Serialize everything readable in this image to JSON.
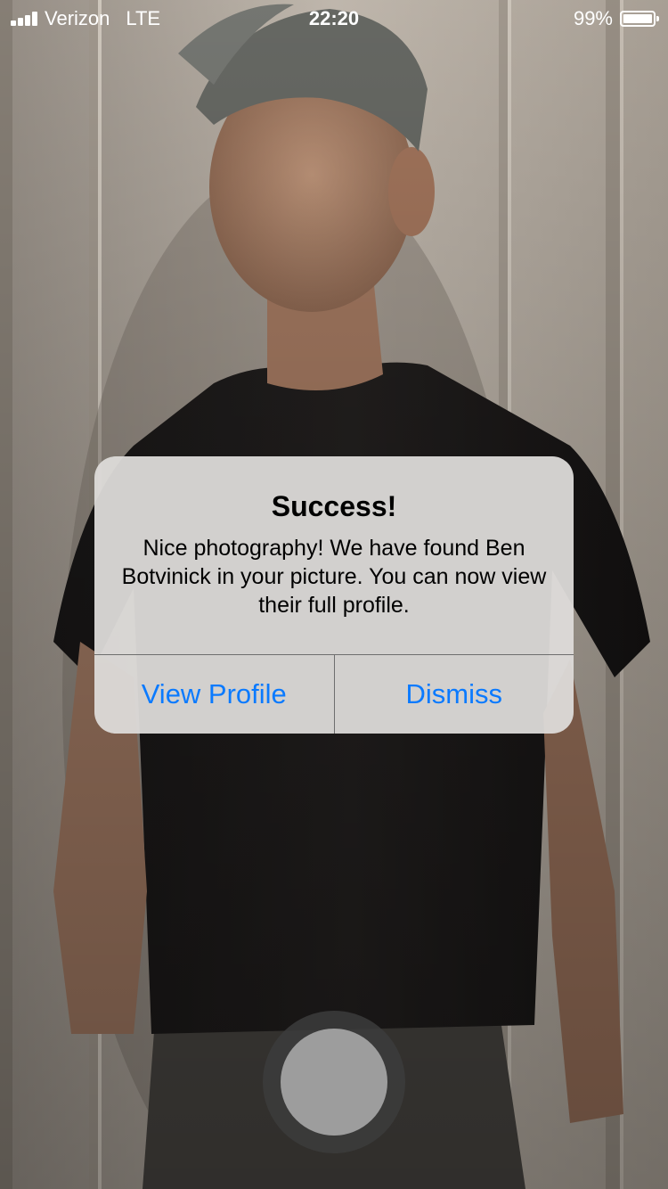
{
  "status_bar": {
    "carrier": "Verizon",
    "network": "LTE",
    "time": "22:20",
    "battery_percent": "99%",
    "battery_level": 0.99,
    "signal_bars": 4
  },
  "alert": {
    "title": "Success!",
    "message": "Nice photography! We have found Ben Botvinick in your picture. You can now view their full profile.",
    "buttons": {
      "view_profile": "View Profile",
      "dismiss": "Dismiss"
    }
  },
  "camera": {
    "shutter_icon": "shutter-button-icon"
  },
  "colors": {
    "accent": "#0a7aff",
    "alert_background": "#dedcda"
  }
}
